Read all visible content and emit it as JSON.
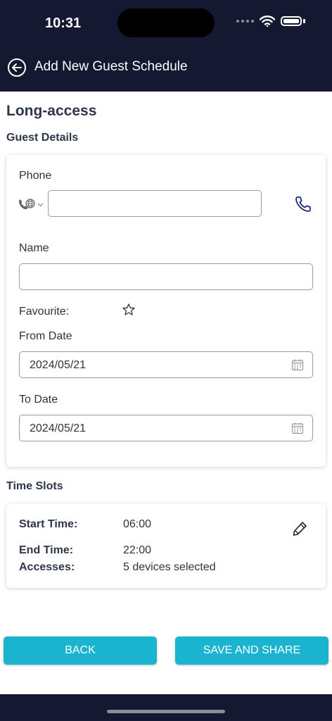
{
  "status_bar": {
    "time": "10:31"
  },
  "header": {
    "title": "Add New Guest Schedule"
  },
  "page": {
    "title": "Long-access"
  },
  "guest_details": {
    "section_title": "Guest Details",
    "phone_label": "Phone",
    "phone_value": "",
    "name_label": "Name",
    "name_value": "",
    "favourite_label": "Favourite:",
    "from_date_label": "From Date",
    "from_date_value": "2024/05/21",
    "to_date_label": "To Date",
    "to_date_value": "2024/05/21"
  },
  "time_slots": {
    "section_title": "Time Slots",
    "start_time_label": "Start Time:",
    "start_time_value": "06:00",
    "end_time_label": "End Time:",
    "end_time_value": "22:00",
    "accesses_label": "Accesses:",
    "accesses_value": "5 devices selected"
  },
  "actions": {
    "back_label": "BACK",
    "save_label": "SAVE AND SHARE"
  },
  "colors": {
    "navy": "#141830",
    "accent": "#1ab4d0",
    "phone_icon": "#1a237e"
  }
}
